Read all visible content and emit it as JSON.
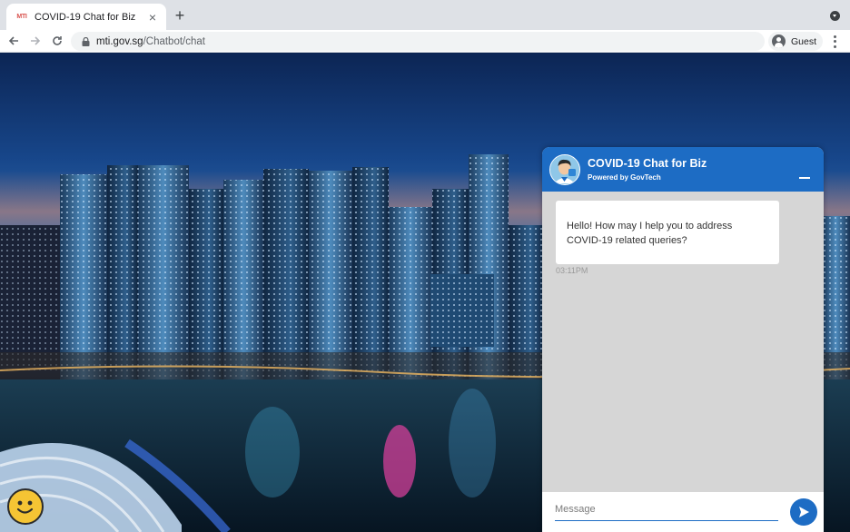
{
  "browser": {
    "tab": {
      "favicon_text": "MTI",
      "title": "COVID-19 Chat for Biz",
      "close_icon": "close-icon"
    },
    "new_tab_icon": "plus-icon",
    "address": {
      "domain": "mti.gov.sg",
      "path": "/Chatbot/chat"
    },
    "profile_label": "Guest"
  },
  "chat": {
    "title": "COVID-19 Chat for Biz",
    "subtitle": "Powered by GovTech",
    "messages": [
      {
        "text_line1": "Hello! How may I help you to address",
        "text_line2": "COVID-19 related queries?",
        "time": "03:11PM"
      }
    ],
    "input_placeholder": "Message"
  },
  "colors": {
    "brand_blue": "#1d6cc4",
    "chat_bg": "#d6d6d6",
    "smiley_yellow": "#f5c434"
  }
}
